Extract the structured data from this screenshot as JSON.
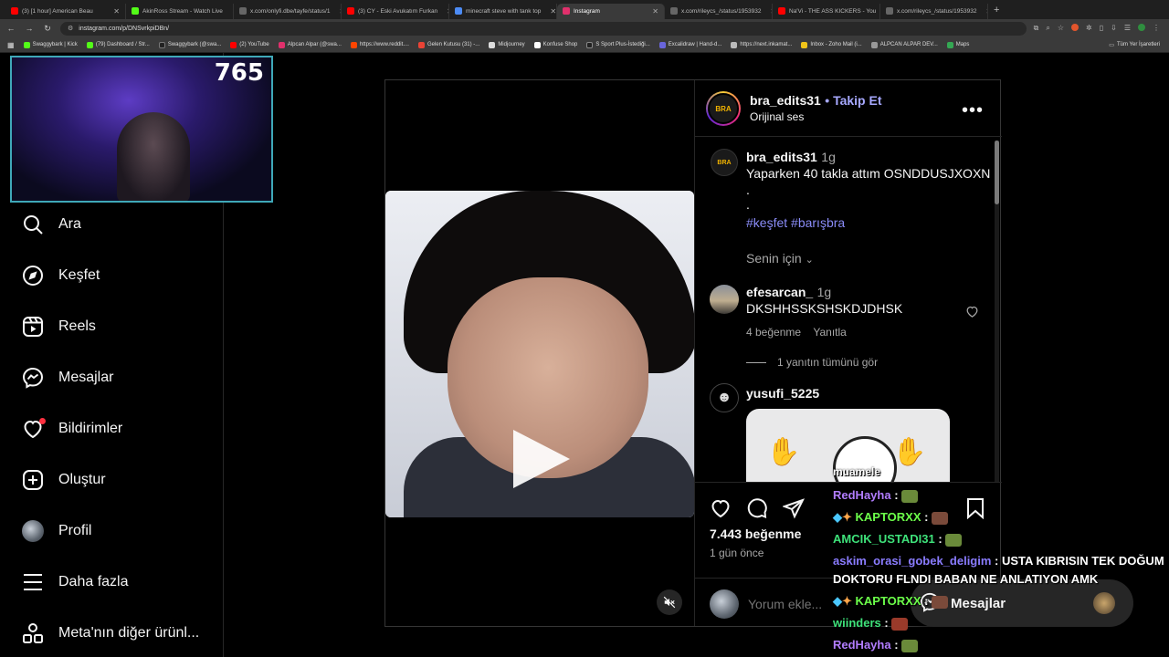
{
  "browser": {
    "tabs": [
      {
        "label": "(3) [1 hour] American Beau",
        "color": "#ff0000"
      },
      {
        "label": "AkinRoss Stream - Watch Live",
        "color": "#53fc18"
      },
      {
        "label": "x.com/onlyfi.dbe/tayfe/status/1",
        "color": "#666666"
      },
      {
        "label": "(3) CY - Eski Avukatım Furkan",
        "color": "#ff0000"
      },
      {
        "label": "minecraft steve with tank top",
        "color": "#4c8bf5"
      },
      {
        "label": "Instagram",
        "color": "#e1306c"
      },
      {
        "label": "x.com/rileycs_/status/1953932",
        "color": "#666666"
      },
      {
        "label": "Na'Vi - THE ASS KICKERS - You",
        "color": "#ff0000"
      },
      {
        "label": "x.com/rileycs_/status/1953932",
        "color": "#666666"
      }
    ],
    "url": "instagram.com/p/DNSvrkpiDBn/",
    "bookmarks": [
      "Swaggybark | Kick",
      "(79) Dashboard / Str...",
      "Swaggybark (@swa...",
      "(2) YouTube",
      "Alpcan Alpar (@swa...",
      "https://www.reddit....",
      "Gelen Kutusu (31) -...",
      "Midjourney",
      "Konfuse Shop",
      "S Sport Plus-İstediği...",
      "Excalidraw | Hand-d...",
      "https://next.inkamat...",
      "Inbox - Zoho Mail (i...",
      "ALPCAN ALPAR DEV...",
      "Maps"
    ],
    "bookmarks_right": "Tüm Yer İşaretleri"
  },
  "webcam": {
    "count": "765"
  },
  "sidebar": {
    "items": [
      {
        "label": "Ara",
        "icon": "search-icon"
      },
      {
        "label": "Keşfet",
        "icon": "compass-icon"
      },
      {
        "label": "Reels",
        "icon": "reels-icon"
      },
      {
        "label": "Mesajlar",
        "icon": "messenger-icon"
      },
      {
        "label": "Bildirimler",
        "icon": "heart-icon"
      },
      {
        "label": "Oluştur",
        "icon": "plus-square-icon"
      },
      {
        "label": "Profil",
        "icon": "profile-avatar"
      },
      {
        "label": "Daha fazla",
        "icon": "menu-icon"
      },
      {
        "label": "Meta'nın diğer ürünl...",
        "icon": "apps-icon"
      }
    ]
  },
  "post": {
    "author": "bra_edits31",
    "follow_label": "• Takip Et",
    "audio": "Orijinal ses",
    "avatar_text": "BRA",
    "caption": {
      "user": "bra_edits31",
      "time": "1g",
      "text": "Yaparken 40 takla attım OSNDDUSJXOXN",
      "dots": [
        ".",
        "."
      ],
      "hashtags": "#keşfet #barışbra",
      "translation_hint": "Senin için"
    },
    "comments": [
      {
        "user": "efesarcan_",
        "time": "1g",
        "text": "DKSHHSSKSHSKDJDHSK",
        "likes": "4 beğenme",
        "reply": "Yanıtla",
        "view_replies": "1 yanıtın tümünü gör"
      },
      {
        "user": "yusufi_5225",
        "sticker_caption": "muamele"
      }
    ],
    "likes": "7.443 beğenme",
    "posted": "1 gün önce",
    "comment_placeholder": "Yorum ekle..."
  },
  "chat": [
    {
      "user": "RedHayha",
      "color": "#b27dff",
      "text": ""
    },
    {
      "user": "KAPTORXX",
      "color": "#6cff4a",
      "text": ""
    },
    {
      "user": "AMCIK_USTADI31",
      "color": "#3ee27a",
      "text": ""
    },
    {
      "user": "askim_orasi_gobek_deligim",
      "color": "#8a7cff",
      "text": "USTA KIBRISIN TEK DOĞUM"
    },
    {
      "user": "",
      "color": "#ffffff",
      "text": "DOKTORU FLNDI BABAN NE ANLATIYON AMK"
    },
    {
      "user": "KAPTORXX",
      "color": "#6cff4a",
      "text": ""
    },
    {
      "user": "wiinders",
      "color": "#3ee27a",
      "text": ""
    },
    {
      "user": "RedHayha",
      "color": "#b27dff",
      "text": ""
    }
  ],
  "messages_pill": {
    "label": "Mesajlar"
  }
}
